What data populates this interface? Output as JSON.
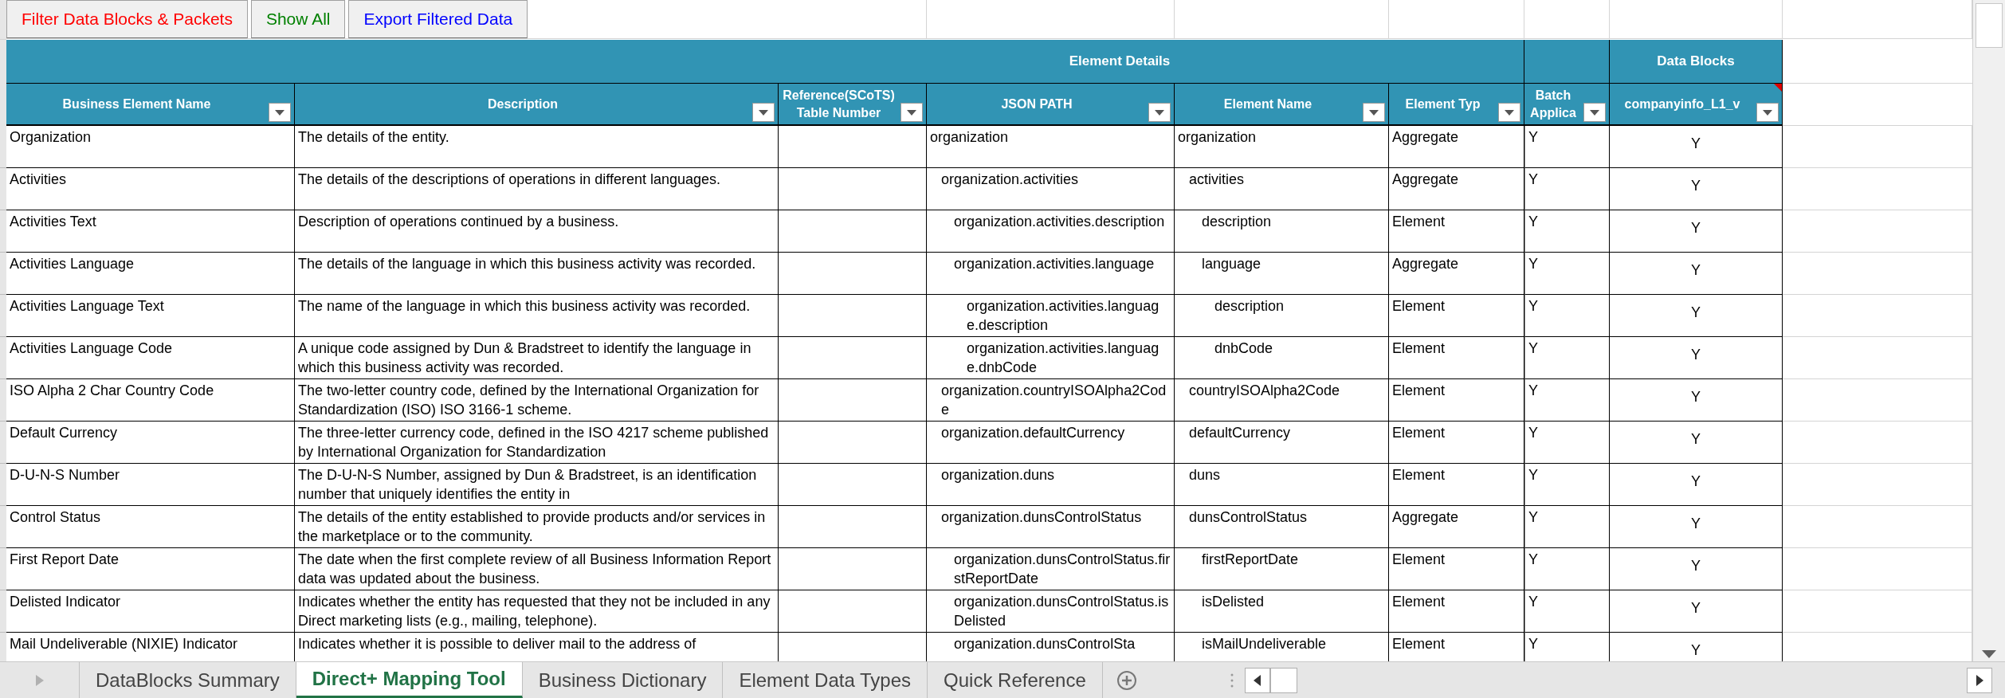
{
  "toolbar": {
    "buttons": [
      {
        "label": "Filter Data Blocks & Packets",
        "color": "#ff0000"
      },
      {
        "label": "Show All",
        "color": "#008000"
      },
      {
        "label": "Export Filtered Data",
        "color": "#0000ff"
      }
    ]
  },
  "table": {
    "group_headers": [
      {
        "label": "Element Details"
      },
      {
        "label": "Data Blocks"
      }
    ],
    "columns": [
      {
        "label": "Business Element Name",
        "note": false
      },
      {
        "label": "Description",
        "note": false
      },
      {
        "label": "Reference(SCoTS) Table Number",
        "note": false
      },
      {
        "label": "JSON PATH",
        "note": false
      },
      {
        "label": "Element Name",
        "note": false
      },
      {
        "label": "Element Typ",
        "note": false
      },
      {
        "label": "Batch Applica",
        "note": false
      },
      {
        "label": "companyinfo_L1_v",
        "note": true
      }
    ],
    "rows": [
      {
        "name": "Organization",
        "description": "The details of the entity.",
        "json_path": "organization",
        "element_name": "organization",
        "element_type": "Aggregate",
        "batch": "Y",
        "companyinfo": "Y",
        "children": [
          {
            "name": "Activities",
            "description": "The details of the descriptions of operations in different languages.",
            "json_path": "organization.activities",
            "element_name": "activities",
            "element_type": "Aggregate",
            "batch": "Y",
            "companyinfo": "Y",
            "children": [
              {
                "name": "Activities Text",
                "description": "Description of operations continued by a business.",
                "json_path": "organization.activities.description",
                "element_name": "description",
                "element_type": "Element",
                "batch": "Y",
                "companyinfo": "Y"
              },
              {
                "name": "Activities Language",
                "description": "The details of the language in which this business activity was recorded.",
                "json_path": "organization.activities.language",
                "element_name": "language",
                "element_type": "Aggregate",
                "batch": "Y",
                "companyinfo": "Y",
                "children": [
                  {
                    "name": "Activities Language Text",
                    "description": "The name of the language in which this business activity was recorded.",
                    "json_path": "organization.activities.language.description",
                    "element_name": "description",
                    "element_type": "Element",
                    "batch": "Y",
                    "companyinfo": "Y"
                  },
                  {
                    "name": "Activities Language Code",
                    "description": "A unique code assigned by Dun & Bradstreet to identify the language in which this business activity was recorded.",
                    "json_path": "organization.activities.language.dnbCode",
                    "element_name": "dnbCode",
                    "element_type": "Element",
                    "batch": "Y",
                    "companyinfo": "Y"
                  }
                ]
              }
            ]
          },
          {
            "name": "ISO Alpha 2 Char Country Code",
            "description": "The two-letter country code, defined by the International Organization for Standardization (ISO) ISO 3166-1 scheme.",
            "json_path": "organization.countryISOAlpha2Code",
            "element_name": "countryISOAlpha2Code",
            "element_type": "Element",
            "batch": "Y",
            "companyinfo": "Y"
          },
          {
            "name": "Default Currency",
            "description": "The three-letter currency code, defined in the ISO 4217 scheme published by International Organization for Standardization",
            "json_path": "organization.defaultCurrency",
            "element_name": "defaultCurrency",
            "element_type": "Element",
            "batch": "Y",
            "companyinfo": "Y"
          },
          {
            "name": "D-U-N-S Number",
            "description": "The D-U-N-S Number, assigned by Dun & Bradstreet, is an identification number that uniquely identifies the entity in",
            "json_path": "organization.duns",
            "element_name": "duns",
            "element_type": "Element",
            "batch": "Y",
            "companyinfo": "Y"
          },
          {
            "name": "Control Status",
            "description": "The details of the entity established to provide products and/or services in the marketplace or to the community.",
            "json_path": "organization.dunsControlStatus",
            "element_name": "dunsControlStatus",
            "element_type": "Aggregate",
            "batch": "Y",
            "companyinfo": "Y",
            "children": [
              {
                "name": "First Report Date",
                "description": "The date when the first complete review of all Business Information Report data was updated about the business.",
                "json_path": "organization.dunsControlStatus.firstReportDate",
                "element_name": "firstReportDate",
                "element_type": "Element",
                "batch": "Y",
                "companyinfo": "Y"
              },
              {
                "name": "Delisted Indicator",
                "description": "Indicates whether the entity has requested that they not be included in any Direct marketing lists (e.g., mailing, telephone).",
                "json_path": "organization.dunsControlStatus.isDelisted",
                "element_name": "isDelisted",
                "element_type": "Element",
                "batch": "Y",
                "companyinfo": "Y"
              },
              {
                "name": "Mail Undeliverable (NIXIE) Indicator",
                "description": "Indicates whether it is possible to deliver mail to the address of",
                "json_path": "organization.dunsControlSta",
                "element_name": "isMailUndeliverable",
                "element_type": "Element",
                "batch": "Y",
                "companyinfo": "Y"
              }
            ]
          }
        ]
      }
    ]
  },
  "sheet_tabs": [
    {
      "label": "DataBlocks Summary",
      "selected": false
    },
    {
      "label": "Direct+ Mapping Tool",
      "selected": true
    },
    {
      "label": "Business Dictionary",
      "selected": false
    },
    {
      "label": "Element Data Types",
      "selected": false
    },
    {
      "label": "Quick Reference",
      "selected": false
    }
  ]
}
